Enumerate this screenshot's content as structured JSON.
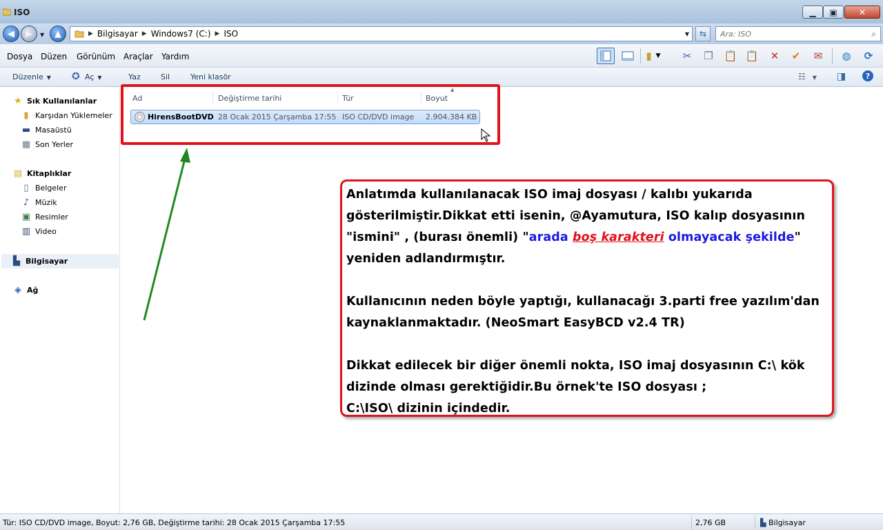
{
  "window": {
    "title": "ISO"
  },
  "address": {
    "segments": [
      "Bilgisayar",
      "Windows7 (C:)",
      "ISO"
    ],
    "search_placeholder": "Ara: ISO"
  },
  "menu": [
    "Dosya",
    "Düzen",
    "Görünüm",
    "Araçlar",
    "Yardım"
  ],
  "toolbar_icons": [
    "details-view-icon",
    "thumbnail-view-icon",
    "folder-options-icon",
    "cut-icon",
    "copy-icon",
    "paste-icon",
    "paste-shortcut-icon",
    "delete-icon",
    "properties-icon",
    "rename-icon",
    "internet-icon",
    "refresh-icon"
  ],
  "command_bar": {
    "organize": "Düzenle",
    "open": "Aç",
    "burn": "Yaz",
    "delete": "Sil",
    "new_folder": "Yeni klasör"
  },
  "nav": {
    "favorites": "Sık Kullanılanlar",
    "downloads": "Karşıdan Yüklemeler",
    "desktop": "Masaüstü",
    "recent": "Son Yerler",
    "libraries": "Kitaplıklar",
    "documents": "Belgeler",
    "music": "Müzik",
    "pictures": "Resimler",
    "video": "Video",
    "computer": "Bilgisayar",
    "network": "Ağ"
  },
  "columns": {
    "name": "Ad",
    "date": "Değiştirme tarihi",
    "type": "Tür",
    "size": "Boyut"
  },
  "file": {
    "name": "HirensBootDVD",
    "date": "28 Ocak 2015 Çarşamba 17:55",
    "type": "ISO CD/DVD image",
    "size": "2.904.384 KB"
  },
  "note": {
    "l1": "Anlatımda kullanılanacak ISO imaj dosyası / kalıbı yukarıda",
    "l2": "gösterilmiştir.Dikkat etti isenin, @Ayamutura, ISO kalıp dosyasının",
    "l3a": "\"ismini\" , (burası önemli) \"",
    "l3b": "arada ",
    "l3c": "boş karakteri",
    "l3d": " olmayacak şekilde",
    "l3e": "\"",
    "l4": "yeniden adlandırmıştır.",
    "l5": "Kullanıcının neden böyle yaptığı, kullanacağı 3.parti free yazılım'dan",
    "l6": "kaynaklanmaktadır. (NeoSmart EasyBCD v2.4 TR)",
    "l7": "Dikkat edilecek bir diğer önemli nokta, ISO imaj dosyasının C:\\ kök",
    "l8": "dizinde olması gerektiğidir.Bu örnek'te ISO dosyası ;",
    "l9": "C:\\ISO\\ dizinin içindedir."
  },
  "status": {
    "details": "Tür: ISO CD/DVD image, Boyut: 2,76 GB, Değiştirme tarihi: 28 Ocak 2015 Çarşamba 17:55",
    "size": "2,76 GB",
    "location": "Bilgisayar"
  },
  "colors": {
    "highlight_red": "#e0121b",
    "highlight_blue": "#1a1ae0",
    "arrow_green": "#1e8a1e"
  }
}
